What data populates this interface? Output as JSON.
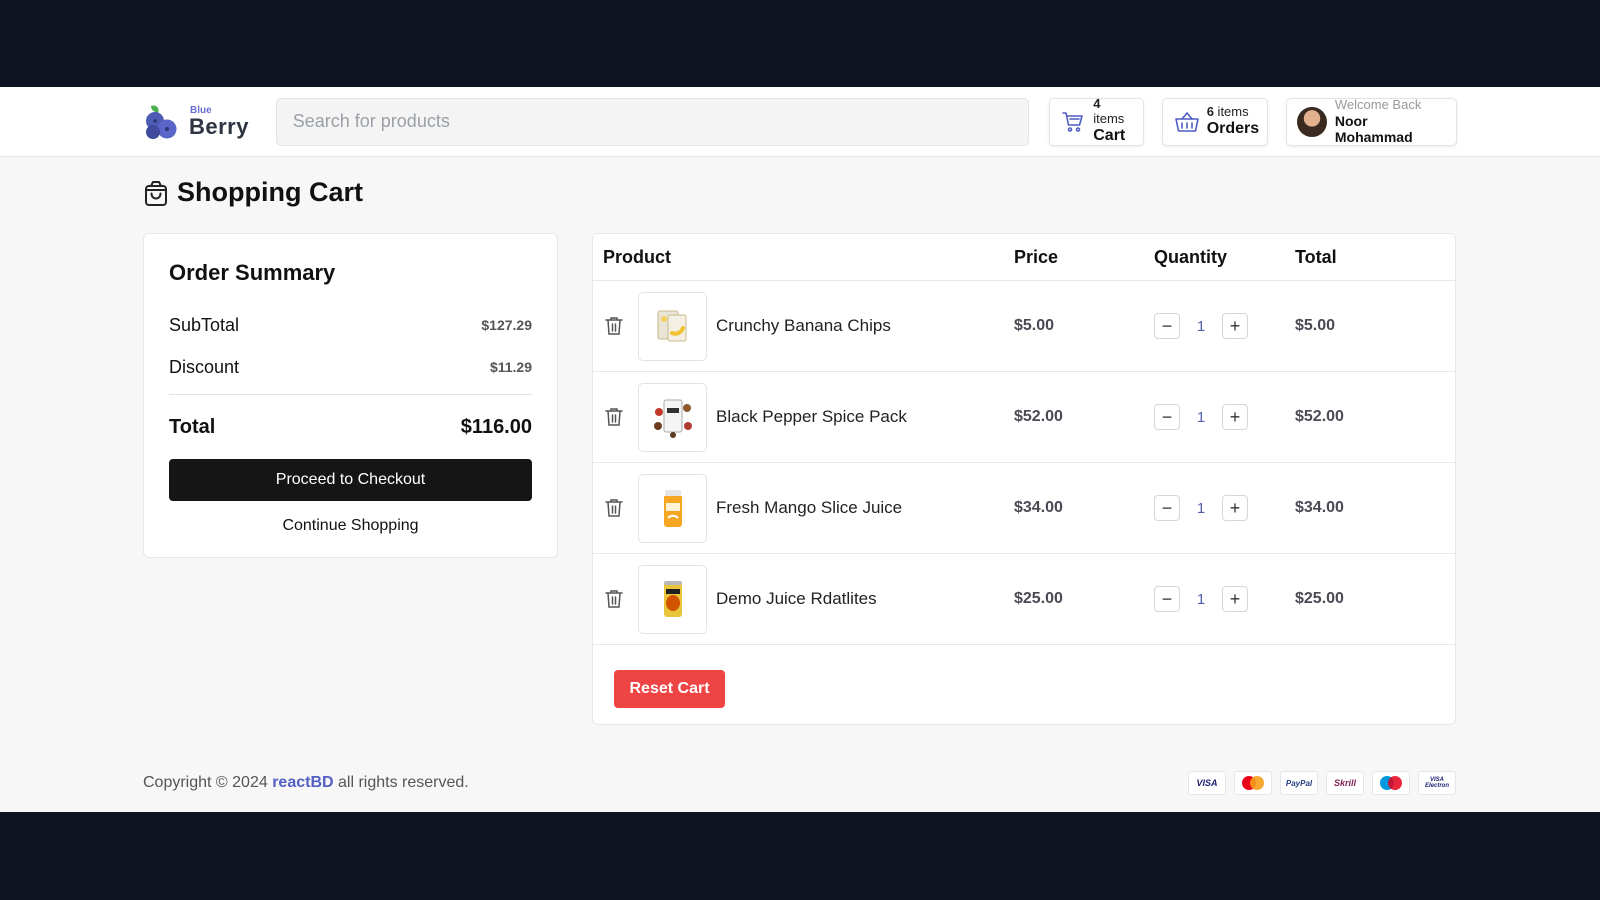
{
  "header": {
    "logo_small": "Blue",
    "logo_big": "Berry",
    "search_placeholder": "Search for products",
    "cart": {
      "count": "4",
      "count_suffix": " items",
      "label": "Cart"
    },
    "orders": {
      "count": "6",
      "count_suffix": " items",
      "label": "Orders"
    },
    "user": {
      "greeting": "Welcome Back",
      "name": "Noor Mohammad"
    }
  },
  "page_title": "Shopping Cart",
  "summary": {
    "title": "Order Summary",
    "subtotal_label": "SubTotal",
    "subtotal_value": "$127.29",
    "discount_label": "Discount",
    "discount_value": "$11.29",
    "total_label": "Total",
    "total_value": "$116.00",
    "checkout_label": "Proceed to Checkout",
    "continue_label": "Continue Shopping"
  },
  "cart": {
    "headers": {
      "product": "Product",
      "price": "Price",
      "quantity": "Quantity",
      "total": "Total"
    },
    "items": [
      {
        "name": "Crunchy Banana Chips",
        "price": "$5.00",
        "qty": "1",
        "total": "$5.00",
        "icon": "banana-chips-product-image"
      },
      {
        "name": "Black Pepper Spice Pack",
        "price": "$52.00",
        "qty": "1",
        "total": "$52.00",
        "icon": "spice-pack-product-image"
      },
      {
        "name": "Fresh Mango Slice Juice",
        "price": "$34.00",
        "qty": "1",
        "total": "$34.00",
        "icon": "mango-juice-product-image"
      },
      {
        "name": "Demo Juice Rdatlites",
        "price": "$25.00",
        "qty": "1",
        "total": "$25.00",
        "icon": "juice-can-product-image"
      }
    ],
    "reset_label": "Reset Cart"
  },
  "footer": {
    "copyright_prefix": "Copyright © 2024 ",
    "brand": "reactBD",
    "copyright_suffix": " all rights reserved.",
    "payment_methods": [
      "VISA",
      "MC",
      "PayPal",
      "Skrill",
      "Maestro",
      "VISA Electron"
    ]
  },
  "colors": {
    "accent": "#5360c4",
    "danger": "#ef4444",
    "dark": "#151515",
    "outer": "#0d1321"
  }
}
